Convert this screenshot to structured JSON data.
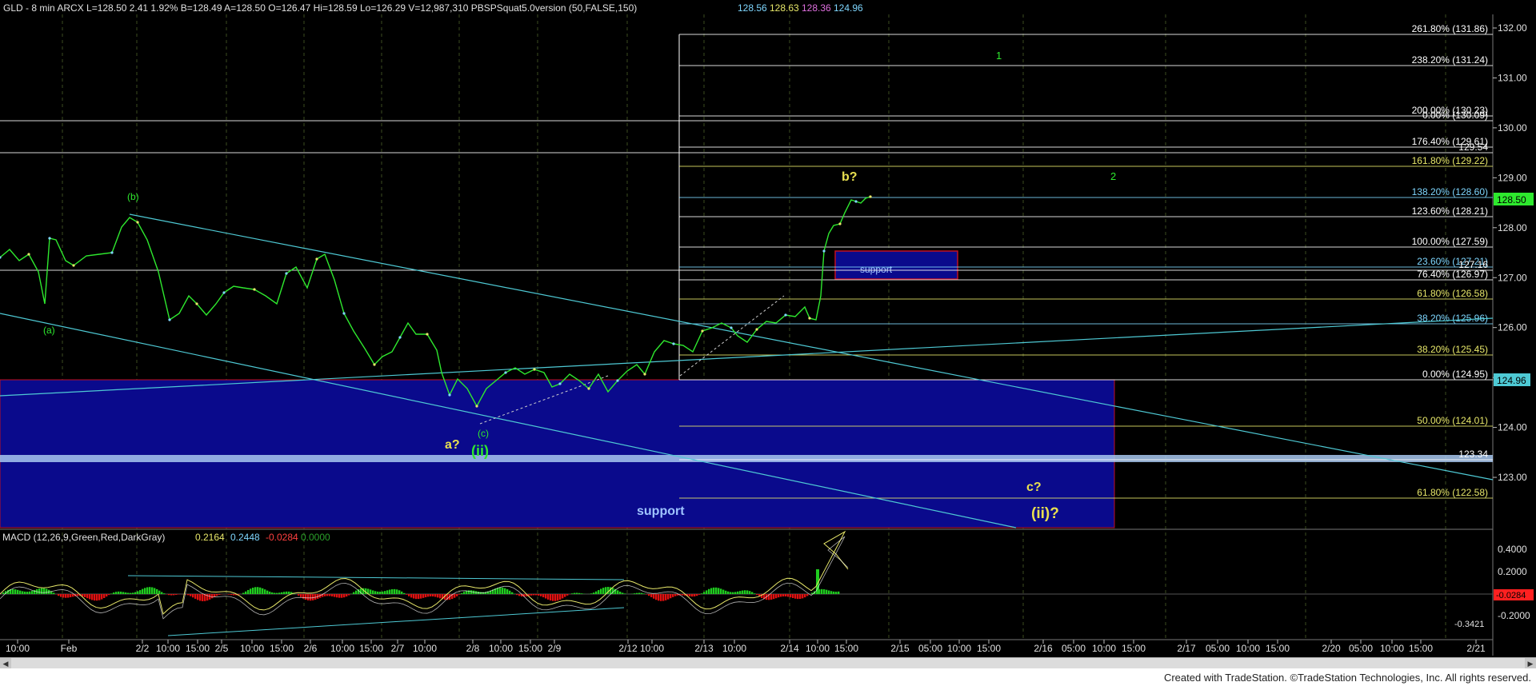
{
  "header": {
    "symbol_line": "GLD - 8 min  ARCX  L=128.50  2.41   1.92%  B=128.49  A=128.50  O=126.47  Hi=128.59  Lo=126.29  V=12,987,310  PBSPSquat5.0version (50,FALSE,150)",
    "indicator_values": [
      "128.56",
      "128.63",
      "128.36",
      "124.96"
    ],
    "indicator_colors": [
      "#7fd7ff",
      "#e8e86a",
      "#e070e0",
      "#7fd7ff"
    ]
  },
  "macd_header": {
    "label": "MACD (12,26,9,Green,Red,DarkGray)",
    "values": [
      "0.2164",
      "0.2448",
      "-0.0284",
      "0.0000"
    ],
    "colors": [
      "#e8e86a",
      "#7fd7ff",
      "#ff4040",
      "#2aa02a"
    ]
  },
  "price_axis": {
    "ticks": [
      "132.00",
      "131.00",
      "130.00",
      "129.00",
      "128.00",
      "127.00",
      "126.00",
      "125.00",
      "124.00",
      "123.00"
    ],
    "last_price": "128.50",
    "marker_124": "124.96"
  },
  "macd_axis": {
    "ticks": [
      "0.4000",
      "0.2000",
      "-0.0284",
      "-0.2000"
    ],
    "min_label": "-0.3421"
  },
  "time_axis": {
    "labels": [
      "10:00",
      "Feb",
      "2/2",
      "10:00",
      "15:00",
      "2/5",
      "10:00",
      "15:00",
      "2/6",
      "10:00",
      "15:00",
      "2/7",
      "10:00",
      "2/8",
      "10:00",
      "15:00",
      "2/9",
      "2/12",
      "10:00",
      "2/13",
      "10:00",
      "2/14",
      "10:00",
      "15:00",
      "2/15",
      "05:00",
      "10:00",
      "15:00",
      "2/16",
      "05:00",
      "10:00",
      "15:00",
      "2/17",
      "05:00",
      "10:00",
      "15:00",
      "2/20",
      "05:00",
      "10:00",
      "15:00",
      "2/21"
    ]
  },
  "fib_levels": [
    {
      "label": "261.80% (131.86)",
      "color": "#ffffff"
    },
    {
      "label": "238.20% (131.24)",
      "color": "#ffffff"
    },
    {
      "label": "200.00% (130.23)",
      "color": "#ffffff"
    },
    {
      "label": "0.00% (130.09)",
      "color": "#ffffff"
    },
    {
      "label": "176.40% (129.61)",
      "color": "#ffffff"
    },
    {
      "label": "129.54",
      "color": "#ffffff"
    },
    {
      "label": "161.80% (129.22)",
      "color": "#e8e86a"
    },
    {
      "label": "138.20% (128.60)",
      "color": "#7fd7ff"
    },
    {
      "label": "123.60% (128.21)",
      "color": "#ffffff"
    },
    {
      "label": "100.00% (127.59)",
      "color": "#ffffff"
    },
    {
      "label": "23.60% (127.21)",
      "color": "#7fd7ff"
    },
    {
      "label": "127.16",
      "color": "#ffffff"
    },
    {
      "label": "76.40% (126.97)",
      "color": "#ffffff"
    },
    {
      "label": "61.80% (126.58)",
      "color": "#e8e86a"
    },
    {
      "label": "38.20% (125.96)",
      "color": "#7fd7ff"
    },
    {
      "label": "38.20% (125.45)",
      "color": "#e8e86a"
    },
    {
      "label": "0.00% (124.95)",
      "color": "#ffffff"
    },
    {
      "label": "50.00% (124.01)",
      "color": "#e8e86a"
    },
    {
      "label": "123.34",
      "color": "#ffffff"
    },
    {
      "label": "61.80% (122.58)",
      "color": "#e8e86a"
    }
  ],
  "annotations": {
    "wave_a_paren": "(a)",
    "wave_b_paren": "(b)",
    "wave_c_paren": "(c)",
    "a_q": "a?",
    "ii": "(ii)",
    "b_q": "b?",
    "c_q": "c?",
    "ii_q": "(ii)?",
    "one": "1",
    "two": "2",
    "support_small": "support",
    "support_big": "support"
  },
  "footer": {
    "credit": "Created with TradeStation. ©TradeStation Technologies, Inc. All rights reserved."
  },
  "chart_data": {
    "type": "line",
    "title": "GLD - 8 min",
    "x": [
      "Feb",
      "2/2",
      "2/5",
      "2/6",
      "2/7",
      "2/8",
      "2/9",
      "2/12",
      "2/13",
      "2/14"
    ],
    "series": [
      {
        "name": "GLD",
        "values": [
          127.5,
          128.1,
          126.6,
          127.2,
          125.9,
          124.6,
          124.8,
          125.7,
          126.2,
          128.5
        ]
      }
    ],
    "ylim": [
      122.0,
      132.2
    ],
    "macd": {
      "macd": 0.2164,
      "signal": 0.2448,
      "histogram": -0.0284,
      "zero": 0.0,
      "min": -0.3421
    },
    "support_zone": [
      122.0,
      124.95
    ]
  }
}
